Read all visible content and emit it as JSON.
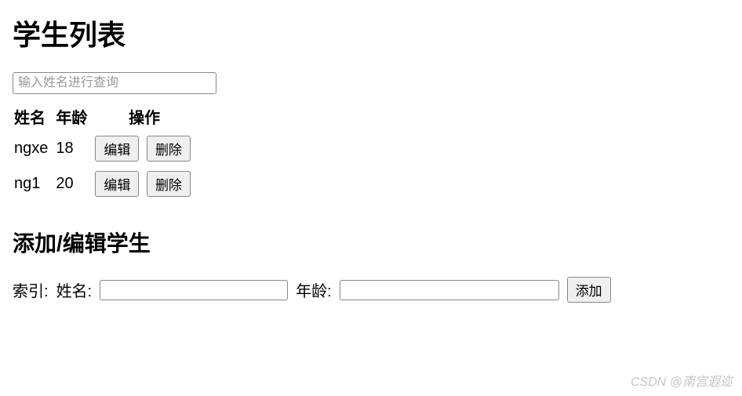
{
  "header": {
    "title": "学生列表"
  },
  "search": {
    "placeholder": "输入姓名进行查询",
    "value": ""
  },
  "table": {
    "headers": {
      "name": "姓名",
      "age": "年龄",
      "actions": "操作"
    },
    "buttons": {
      "edit": "编辑",
      "delete": "删除"
    },
    "rows": [
      {
        "name": "ngxe",
        "age": "18"
      },
      {
        "name": "ng1",
        "age": "20"
      }
    ]
  },
  "form": {
    "title": "添加/编辑学生",
    "labels": {
      "index": "索引:",
      "name": "姓名:",
      "age": "年龄:"
    },
    "values": {
      "index": "",
      "name": "",
      "age": ""
    },
    "submit": "添加"
  },
  "watermark": "CSDN @南宫遐迩"
}
